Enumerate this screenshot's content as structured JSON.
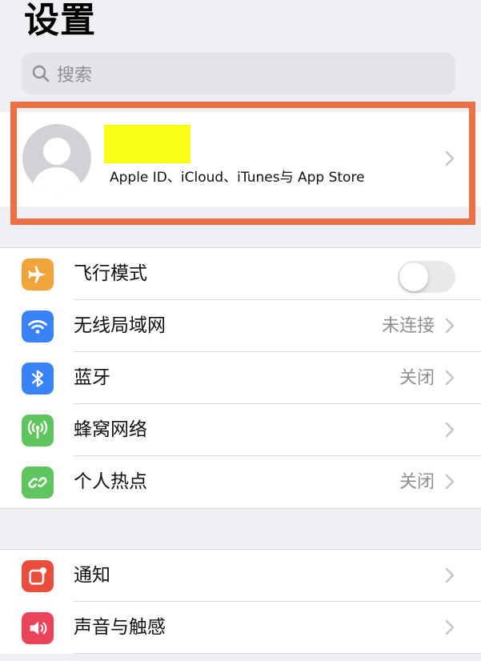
{
  "header": {
    "title": "设置"
  },
  "search": {
    "placeholder": "搜索"
  },
  "profile": {
    "subtitle": "Apple ID、iCloud、iTunes与 App Store"
  },
  "colors": {
    "airplane": "#f1a33c",
    "wifi": "#3a82f7",
    "bluetooth": "#3a82f7",
    "cellular": "#5fc55e",
    "hotspot": "#5fc55e",
    "notifications": "#eb4d3d",
    "sounds": "#eb445a",
    "highlight_border": "#ec6f45",
    "redaction": "#fbff18"
  },
  "group1": {
    "airplane": {
      "label": "飞行模式",
      "icon": "airplane-icon",
      "toggle_on": false
    },
    "wifi": {
      "label": "无线局域网",
      "value": "未连接",
      "icon": "wifi-icon"
    },
    "bluetooth": {
      "label": "蓝牙",
      "value": "关闭",
      "icon": "bluetooth-icon"
    },
    "cellular": {
      "label": "蜂窝网络",
      "icon": "antenna-icon"
    },
    "hotspot": {
      "label": "个人热点",
      "value": "关闭",
      "icon": "hotspot-link-icon"
    }
  },
  "group2": {
    "notifications": {
      "label": "通知",
      "icon": "notification-icon"
    },
    "sounds": {
      "label": "声音与触感",
      "icon": "speaker-icon"
    }
  }
}
